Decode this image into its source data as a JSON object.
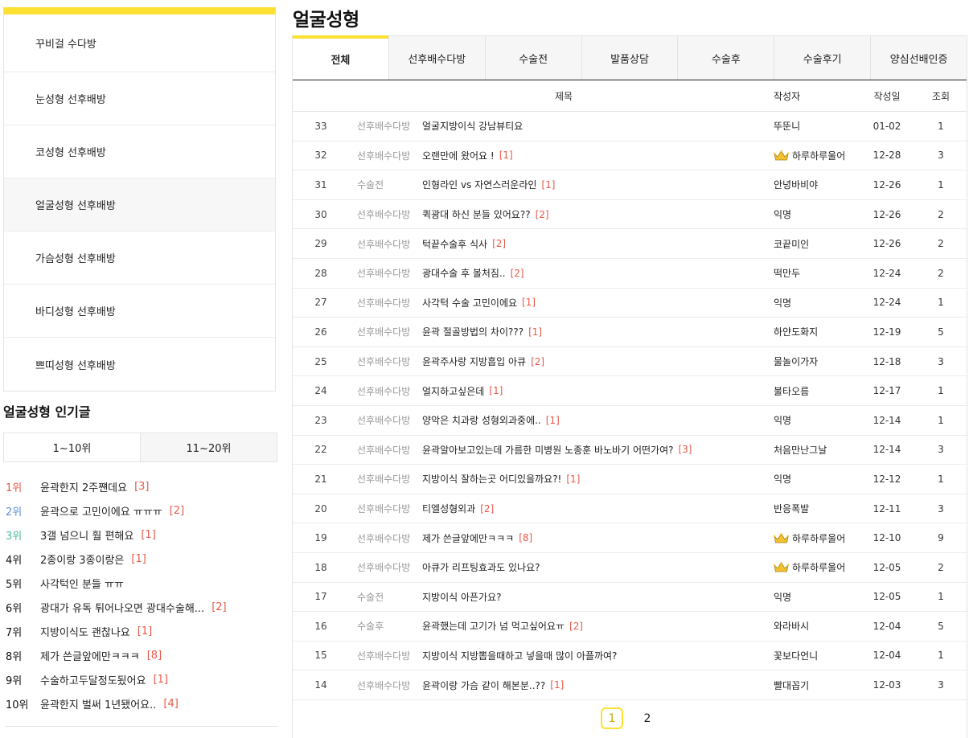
{
  "colors": {
    "accent": "#fce032",
    "count": "#e8584a",
    "rank1": "#e8584a",
    "rank2": "#5b8fd9",
    "rank3": "#4fb99f",
    "category": "#999999"
  },
  "sidebar": {
    "categories": [
      "꾸비걸 수다방",
      "눈성형 선후배방",
      "코성형 선후배방",
      "얼굴성형 선후배방",
      "가슴성형 선후배방",
      "바디성형 선후배방",
      "쁘띠성형 선후배방"
    ],
    "active_index": 3,
    "popular_title": "얼굴성형 인기글",
    "rank_tabs": [
      "1~10위",
      "11~20위"
    ],
    "ranks": [
      {
        "rank": "1위",
        "title": "윤곽한지 2주쨴데요",
        "count": "[3]"
      },
      {
        "rank": "2위",
        "title": "윤곽으로 고민이에요 ㅠㅠㅠ",
        "count": "[2]"
      },
      {
        "rank": "3위",
        "title": "3갤 넘으니 훨 편해요",
        "count": "[1]"
      },
      {
        "rank": "4위",
        "title": "2종이랑 3종이랑은",
        "count": "[1]"
      },
      {
        "rank": "5위",
        "title": "사각턱인 분들 ㅠㅠ",
        "count": ""
      },
      {
        "rank": "6위",
        "title": "광대가 유독 튀어나오면 광대수술해...",
        "count": "[2]"
      },
      {
        "rank": "7위",
        "title": "지방이식도 괜찮나요",
        "count": "[1]"
      },
      {
        "rank": "8위",
        "title": "제가 쓴글앞에만ㅋㅋㅋ",
        "count": "[8]"
      },
      {
        "rank": "9위",
        "title": "수술하고두달정도됬어요",
        "count": "[1]"
      },
      {
        "rank": "10위",
        "title": "윤곽한지 벌써 1년됐어요..",
        "count": "[4]"
      }
    ]
  },
  "board": {
    "title": "얼굴성형",
    "tabs": [
      "전체",
      "선후배수다방",
      "수술전",
      "발품상담",
      "수술후",
      "수술후기",
      "양심선배인증"
    ],
    "active_tab": 0,
    "columns": {
      "title": "제목",
      "author": "작성자",
      "date": "작성일",
      "views": "조회"
    },
    "rows": [
      {
        "num": "33",
        "category": "선후배수다방",
        "subject": "얼굴지방이식 강남뷰티요",
        "count": "",
        "author": "뚜뚠니",
        "crown": false,
        "date": "01-02",
        "views": "1"
      },
      {
        "num": "32",
        "category": "선후배수다방",
        "subject": "오랜만에 왔어요 !",
        "count": "[1]",
        "author": "하루하루울어",
        "crown": true,
        "date": "12-28",
        "views": "3"
      },
      {
        "num": "31",
        "category": "수술전",
        "subject": "인형라인 vs 자연스러운라인",
        "count": "[1]",
        "author": "안녕바비야",
        "crown": false,
        "date": "12-26",
        "views": "1"
      },
      {
        "num": "30",
        "category": "선후배수다방",
        "subject": "퀵광대 하신 분들 있어요??",
        "count": "[2]",
        "author": "익명",
        "crown": false,
        "date": "12-26",
        "views": "2"
      },
      {
        "num": "29",
        "category": "선후배수다방",
        "subject": "턱끝수술후 식사",
        "count": "[2]",
        "author": "코끝미인",
        "crown": false,
        "date": "12-26",
        "views": "2"
      },
      {
        "num": "28",
        "category": "선후배수다방",
        "subject": "광대수술 후 볼처짐..",
        "count": "[2]",
        "author": "떡만두",
        "crown": false,
        "date": "12-24",
        "views": "2"
      },
      {
        "num": "27",
        "category": "선후배수다방",
        "subject": "사각턱 수술 고민이에요",
        "count": "[1]",
        "author": "익명",
        "crown": false,
        "date": "12-24",
        "views": "1"
      },
      {
        "num": "26",
        "category": "선후배수다방",
        "subject": "윤곽 절골방법의 차이???",
        "count": "[1]",
        "author": "하얀도화지",
        "crown": false,
        "date": "12-19",
        "views": "5"
      },
      {
        "num": "25",
        "category": "선후배수다방",
        "subject": "윤곽주사랑 지방흡입 아큐",
        "count": "[2]",
        "author": "물놀이가자",
        "crown": false,
        "date": "12-18",
        "views": "3"
      },
      {
        "num": "24",
        "category": "선후배수다방",
        "subject": "얼지하고싶은데",
        "count": "[1]",
        "author": "불타오름",
        "crown": false,
        "date": "12-17",
        "views": "1"
      },
      {
        "num": "23",
        "category": "선후배수다방",
        "subject": "양악은 치과랑 성형외과중에..",
        "count": "[1]",
        "author": "익명",
        "crown": false,
        "date": "12-14",
        "views": "1"
      },
      {
        "num": "22",
        "category": "선후배수다방",
        "subject": "윤곽알아보고있는데 가름한 미병원 노종훈 바노바기 어떤가여?",
        "count": "[3]",
        "author": "처음만난그날",
        "crown": false,
        "date": "12-14",
        "views": "3"
      },
      {
        "num": "21",
        "category": "선후배수다방",
        "subject": "지방이식 잘하는곳 어디있을까요?!",
        "count": "[1]",
        "author": "익명",
        "crown": false,
        "date": "12-12",
        "views": "1"
      },
      {
        "num": "20",
        "category": "선후배수다방",
        "subject": "티엘성형외과",
        "count": "[2]",
        "author": "반응폭발",
        "crown": false,
        "date": "12-11",
        "views": "3"
      },
      {
        "num": "19",
        "category": "선후배수다방",
        "subject": "제가 쓴글앞에만ㅋㅋㅋ",
        "count": "[8]",
        "author": "하루하루울어",
        "crown": true,
        "date": "12-10",
        "views": "9"
      },
      {
        "num": "18",
        "category": "선후배수다방",
        "subject": "아큐가 리프팅효과도 있나요?",
        "count": "",
        "author": "하루하루울어",
        "crown": true,
        "date": "12-05",
        "views": "2"
      },
      {
        "num": "17",
        "category": "수술전",
        "subject": "지방이식 아픈가요?",
        "count": "",
        "author": "익명",
        "crown": false,
        "date": "12-05",
        "views": "1"
      },
      {
        "num": "16",
        "category": "수술후",
        "subject": "윤곽했는데 고기가 넘 먹고싶어요ㅠ",
        "count": "[2]",
        "author": "와라바시",
        "crown": false,
        "date": "12-04",
        "views": "5"
      },
      {
        "num": "15",
        "category": "선후배수다방",
        "subject": "지방이식 지방뽑을때하고 넣을때 많이 아플까여?",
        "count": "",
        "author": "꽃보다언니",
        "crown": false,
        "date": "12-04",
        "views": "1"
      },
      {
        "num": "14",
        "category": "선후배수다방",
        "subject": "윤곽이랑 가슴 같이 해본분..??",
        "count": "[1]",
        "author": "빨대꼽기",
        "crown": false,
        "date": "12-03",
        "views": "3"
      }
    ],
    "pages": [
      "1",
      "2"
    ],
    "current_page": 0
  }
}
